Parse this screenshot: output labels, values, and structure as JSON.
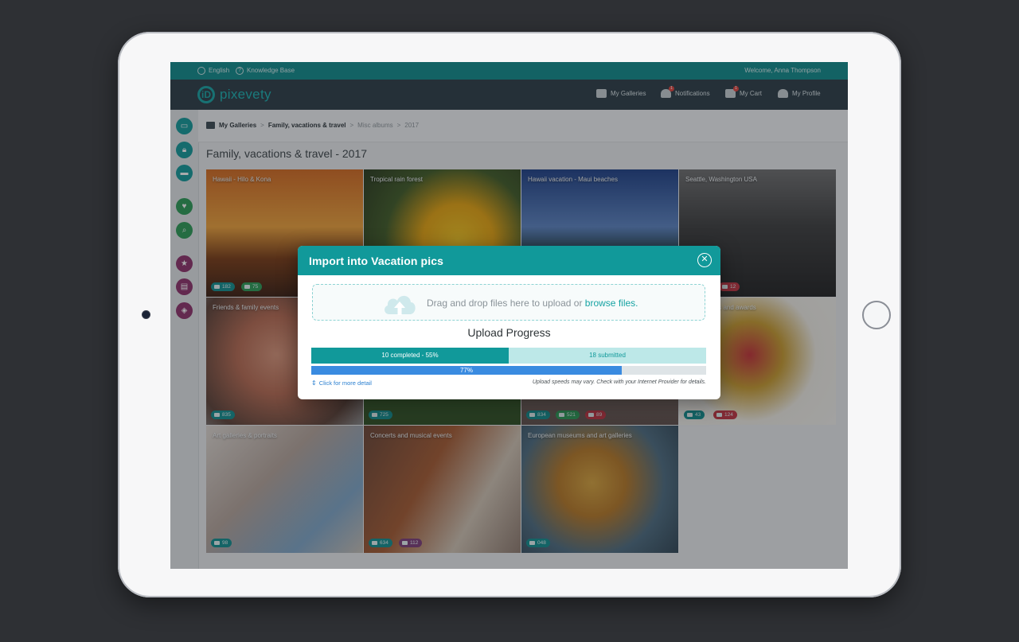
{
  "util_bar": {
    "language": "English",
    "knowledge_base": "Knowledge Base",
    "welcome": "Welcome,  Anna Thompson"
  },
  "nav": {
    "logo": "pixevety",
    "my_galleries": "My Galleries",
    "notifications": "Notifications",
    "notifications_badge": "1",
    "cart": "My Cart",
    "cart_badge": "1",
    "profile": "My Profile"
  },
  "sidebar": {
    "icons": [
      {
        "name": "gallery-icon",
        "color": "#11999a"
      },
      {
        "name": "lock-icon",
        "color": "#11999a"
      },
      {
        "name": "folder-icon",
        "color": "#11999a"
      },
      {
        "name": "heart-icon",
        "color": "#2b9c55"
      },
      {
        "name": "search-icon",
        "color": "#2b9c55"
      },
      {
        "name": "star-icon",
        "color": "#8e2f6a"
      },
      {
        "name": "albums-icon",
        "color": "#8e2f6a"
      },
      {
        "name": "box-icon",
        "color": "#8e2f6a"
      }
    ]
  },
  "breadcrumb": {
    "root": "My Galleries",
    "sep": ">",
    "level1": "Family, vacations & travel",
    "level2": "Misc albums",
    "level3": "2017"
  },
  "page_title": "Family, vacations & travel - 2017",
  "gallery": [
    {
      "caption": "Hawaii - Hilo & Kona",
      "chips": [
        {
          "type": "teal",
          "value": "182"
        },
        {
          "type": "green",
          "value": "75"
        }
      ]
    },
    {
      "caption": "Tropical rain forest",
      "chips": []
    },
    {
      "caption": "Hawaii vacation - Maui beaches",
      "chips": []
    },
    {
      "caption": "Seattle, Washington USA",
      "chips": [
        {
          "type": "red",
          "value": "12"
        }
      ]
    },
    {
      "caption": "Friends & family events",
      "chips": [
        {
          "type": "teal",
          "value": "835"
        }
      ]
    },
    {
      "caption": "",
      "chips": [
        {
          "type": "teal",
          "value": "725"
        }
      ]
    },
    {
      "caption": "",
      "chips": [
        {
          "type": "teal",
          "value": "834"
        },
        {
          "type": "green",
          "value": "521"
        },
        {
          "type": "red",
          "value": "89"
        }
      ]
    },
    {
      "caption": "ts and awards",
      "chips": [
        {
          "type": "teal",
          "value": "43"
        },
        {
          "type": "red",
          "value": "124"
        }
      ]
    },
    {
      "caption": "Art galleries & portraits",
      "chips": [
        {
          "type": "teal",
          "value": "98"
        }
      ]
    },
    {
      "caption": "Concerts and musical events",
      "chips": [
        {
          "type": "teal",
          "value": "634"
        },
        {
          "type": "purple",
          "value": "112"
        }
      ]
    },
    {
      "caption": "European museums and art galleries",
      "chips": [
        {
          "type": "teal",
          "value": "048"
        }
      ]
    }
  ],
  "modal": {
    "title": "Import into Vacation pics",
    "drop_text": "Drag and drop files here to upload or ",
    "browse": "browse files.",
    "heading": "Upload Progress",
    "completed_label": "10 completed - 55%",
    "completed_fraction": 0.5,
    "submitted_label": "18 submitted",
    "overall_label": "77%",
    "overall_fraction": 0.786,
    "detail_link": "Click for more detail",
    "note": "Upload speeds may vary. Check with your Internet Provider for details."
  },
  "colors": {
    "accent": "#11999a",
    "green": "#2b9c55",
    "red": "#c23240",
    "purple": "#7d3b78",
    "blue_progress": "#3a8be0"
  }
}
